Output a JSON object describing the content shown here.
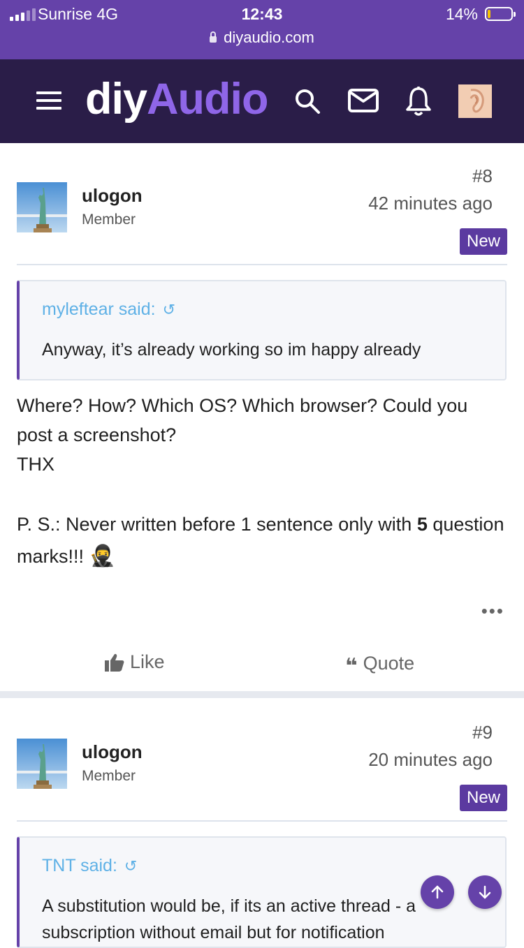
{
  "status_bar": {
    "carrier": "Sunrise  4G",
    "time": "12:43",
    "battery": "14%",
    "battery_level": 0.14,
    "url": "diyaudio.com"
  },
  "header": {
    "logo_part1": "diy",
    "logo_part2": "Audio",
    "icons": [
      "menu-icon",
      "search-icon",
      "mail-icon",
      "bell-icon",
      "avatar"
    ]
  },
  "posts": [
    {
      "author": "ulogon",
      "role": "Member",
      "number": "#8",
      "time": "42 minutes ago",
      "badge": "New",
      "quote": {
        "author_line": "myleftear said:",
        "text": "Anyway, it’s already working so im happy already"
      },
      "body": [
        "Where? How? Which OS? Which browser? Could you post a screenshot?",
        "THX",
        "P. S.: Never written before 1 sentence only with",
        "5",
        "question marks!!!"
      ],
      "emoji": "🥷",
      "more": "•••",
      "actions": {
        "like": "Like",
        "quote": "Quote"
      }
    },
    {
      "author": "ulogon",
      "role": "Member",
      "number": "#9",
      "time": "20 minutes ago",
      "badge": "New",
      "quote": {
        "author_line": "TNT said:",
        "text": "A substitution would be, if its an active thread - a",
        "text2": "subscription without email but for notification"
      }
    }
  ],
  "colors": {
    "status_bar": "#6542a9",
    "header": "#2a1d48",
    "logo_accent": "#8f66e8",
    "badge": "#5b3aa0",
    "quote_author": "#5fb1e6"
  }
}
